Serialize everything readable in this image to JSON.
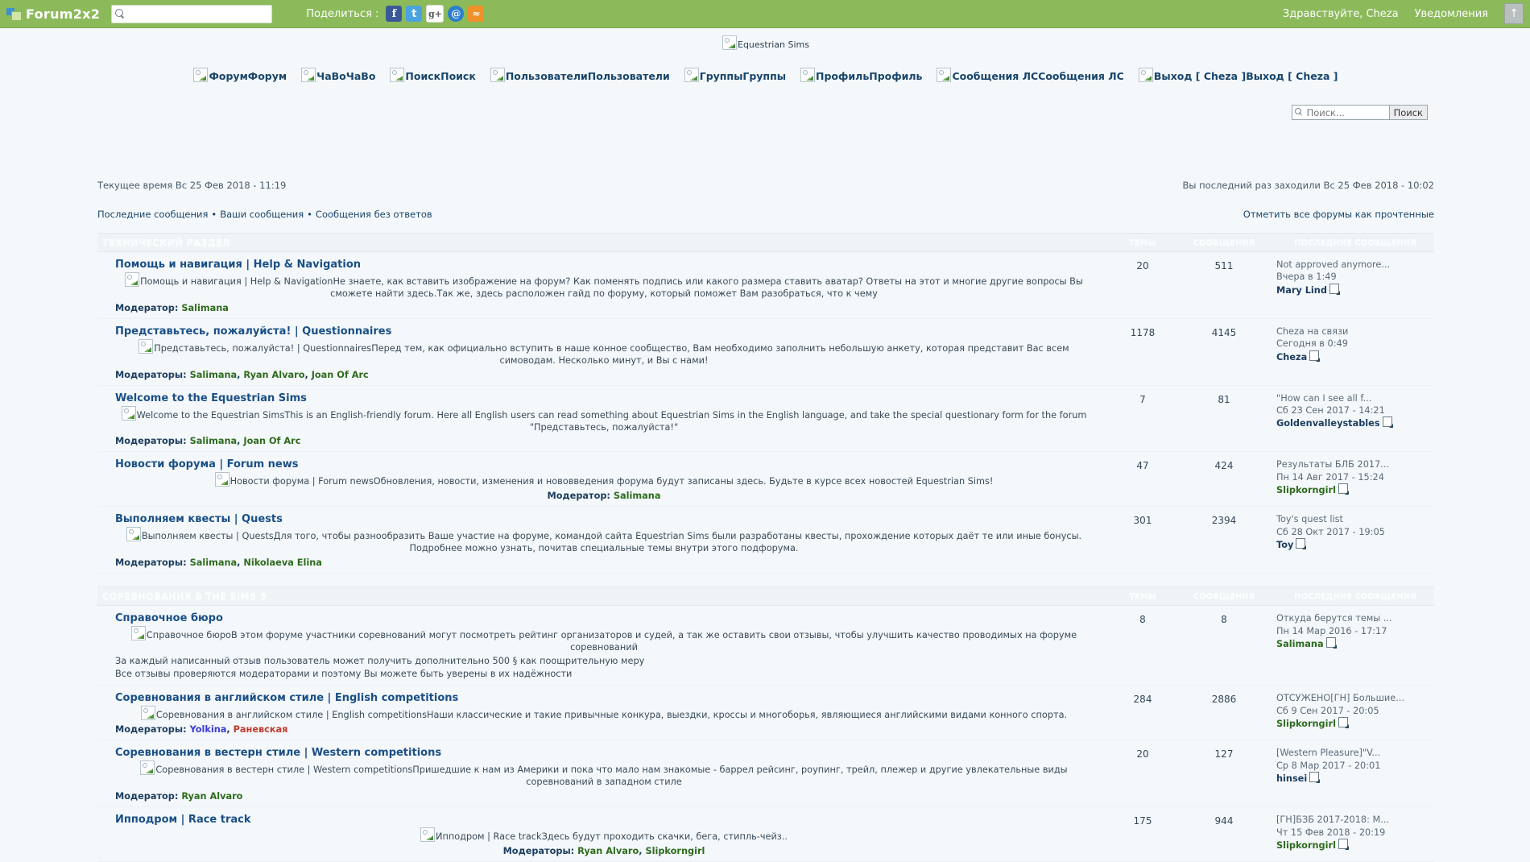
{
  "topbar": {
    "brand": "Forum2x2",
    "search_placeholder": "",
    "search_value": "",
    "share_label": "Поделиться :",
    "social": [
      {
        "name": "facebook-icon",
        "glyph": "f"
      },
      {
        "name": "twitter-icon",
        "glyph": "t"
      },
      {
        "name": "google-plus-icon",
        "glyph": "g+"
      },
      {
        "name": "email-icon",
        "glyph": "@"
      },
      {
        "name": "rss-icon",
        "glyph": "ᴿ"
      }
    ],
    "greeting": "Здравствуйте, Cheza",
    "notifications": "Уведомления",
    "scroll_top": "↑"
  },
  "header": {
    "logo_alt": "Equestrian Sims",
    "nav": [
      {
        "alt": "Форум",
        "label": "Форум"
      },
      {
        "alt": "ЧаВо",
        "label": "ЧаВо"
      },
      {
        "alt": "Поиск",
        "label": "Поиск"
      },
      {
        "alt": "Пользователи",
        "label": "Пользователи"
      },
      {
        "alt": "Группы",
        "label": "Группы"
      },
      {
        "alt": "Профиль",
        "label": "Профиль"
      },
      {
        "alt": "Сообщения ЛС",
        "label": "Сообщения ЛС"
      },
      {
        "alt": "Выход [ Cheza ]",
        "label": "Выход [ Cheza ]"
      }
    ],
    "search_placeholder": "Поиск...",
    "search_button": "Поиск"
  },
  "status": {
    "current_time": "Текущее время Вс 25 Фев 2018 - 11:19",
    "last_visit": "Вы последний раз заходили Вс 25 Фев 2018 - 10:02",
    "links": [
      "Последние сообщения",
      "Ваши сообщения",
      "Сообщения без ответов"
    ],
    "separator": "•",
    "mark_read": "Отметить все форумы как прочтенные"
  },
  "columns": {
    "topics": "Темы",
    "posts": "Сообщения",
    "last_post": "Последние сообщения"
  },
  "categories": [
    {
      "title": "Технический раздел",
      "forums": [
        {
          "name": "Помощь и навигация | Help & Navigation",
          "desc_alt": "Помощь и навигация | Help & Navigation",
          "desc": "Не знаете, как вставить изображение на форум? Как поменять подпись или какого размера ставить аватар? Ответы на этот и многие другие вопросы Вы сможете найти здесь.Так же, здесь расположен гайд по форуму, который поможет Вам разобраться, что к чему",
          "mod_label": "Модератор:",
          "mods": [
            {
              "name": "Salimana",
              "color": "m-green"
            }
          ],
          "mods_center": false,
          "topics": "20",
          "posts": "511",
          "last_title": "Not approved anymore...",
          "last_date": "Вчера в 1:49",
          "last_author": "Mary Lind",
          "last_author_color": "#1b3c5e"
        },
        {
          "name": "Представьтесь, пожалуйста! | Questionnaires",
          "desc_alt": "Представьтесь, пожалуйста! | Questionnaires",
          "desc": "Перед тем, как официально вступить в наше конное сообщество, Вам необходимо заполнить небольшую анкету, которая представит Вас всем симоводам. Несколько минут, и Вы с нами!",
          "mod_label": "Модераторы:",
          "mods": [
            {
              "name": "Salimana",
              "color": "m-green"
            },
            {
              "name": "Ryan Alvaro",
              "color": "m-green"
            },
            {
              "name": "Joan Of Arc",
              "color": "m-green"
            }
          ],
          "mods_center": false,
          "topics": "1178",
          "posts": "4145",
          "last_title": "Cheza на связи",
          "last_date": "Сегодня в 0:49",
          "last_author": "Cheza",
          "last_author_color": "#1b3c5e"
        },
        {
          "name": "Welcome to the Equestrian Sims",
          "desc_alt": "Welcome to the Equestrian Sims",
          "desc": "This is an English-friendly forum. Here all English users can read something about Equestrian Sims in the English language, and take the special questionary form for the forum \"Представьтесь, пожалуйста!\"",
          "mod_label": "Модераторы:",
          "mods": [
            {
              "name": "Salimana",
              "color": "m-green"
            },
            {
              "name": "Joan Of Arc",
              "color": "m-green"
            }
          ],
          "mods_center": false,
          "topics": "7",
          "posts": "81",
          "last_title": "\"How can I see all f...",
          "last_date": "Сб 23 Сен 2017 - 14:21",
          "last_author": "Goldenvalleystables",
          "last_author_color": "#1b3c5e"
        },
        {
          "name": "Новости форума | Forum news",
          "desc_alt": "Новости форума | Forum news",
          "desc": "Обновления, новости, изменения и нововведения форума будут записаны здесь. Будьте в курсе всех новостей Equestrian Sims!",
          "mod_label": "Модератор:",
          "mods": [
            {
              "name": "Salimana",
              "color": "m-green"
            }
          ],
          "mods_center": true,
          "topics": "47",
          "posts": "424",
          "last_title": "Результаты БЛБ 2017...",
          "last_date": "Пн 14 Авг 2017 - 15:24",
          "last_author": "Slipkorngirl",
          "last_author_color": "#2e6b1e"
        },
        {
          "name": "Выполняем квесты | Quests",
          "desc_alt": "Выполняем квесты | Quests",
          "desc": "Для того, чтобы разнообразить Ваше участие на форуме, командой сайта Equestrian Sims были разработаны квесты, прохождение которых даёт те или иные бонусы. Подробнее можно узнать, почитав специальные темы внутри этого подфорума.",
          "mod_label": "Модераторы:",
          "mods": [
            {
              "name": "Salimana",
              "color": "m-green"
            },
            {
              "name": "Nikolaeva Elina",
              "color": "m-green"
            }
          ],
          "mods_center": false,
          "topics": "301",
          "posts": "2394",
          "last_title": "Toy's quest list",
          "last_date": "Сб 28 Окт 2017 - 19:05",
          "last_author": "Toy",
          "last_author_color": "#1b3c5e"
        }
      ]
    },
    {
      "title": "Соревнования в The Sims 3",
      "forums": [
        {
          "name": "Справочное бюро",
          "desc_alt": "Справочное бюро",
          "desc": "В этом форуме участники соревнований могут посмотреть рейтинг организаторов и судей, а так же оставить свои отзывы, чтобы улучшить качество проводимых на форуме соревнований",
          "extra": [
            "За каждый написанный отзыв пользователь может получить дополнительно 500 § как поощрительную меру",
            "Все отзывы проверяются модераторами и поэтому Вы можете быть уверены в их надёжности"
          ],
          "mod_label": "",
          "mods": [],
          "mods_center": false,
          "topics": "8",
          "posts": "8",
          "last_title": "Откуда берутся темы ...",
          "last_date": "Пн 14 Мар 2016 - 17:17",
          "last_author": "Salimana",
          "last_author_color": "#2e6b1e"
        },
        {
          "name": "Соревнования в английском стиле | English competitions",
          "desc_alt": "Соревнования в английском стиле | English competitions",
          "desc": "Наши классические и такие привычные конкура, выездки, кроссы и многоборья, являющиеся английскими видами конного спорта.",
          "mod_label": "Модераторы:",
          "mods": [
            {
              "name": "Yolkina",
              "color": "m-blue"
            },
            {
              "name": "Раневская",
              "color": "m-red"
            }
          ],
          "mods_center": false,
          "topics": "284",
          "posts": "2886",
          "last_title": "ОТСУЖЕНО[ГН] Большие...",
          "last_date": "Сб 9 Сен 2017 - 20:05",
          "last_author": "Slipkorngirl",
          "last_author_color": "#2e6b1e"
        },
        {
          "name": "Соревнования в вестерн стиле | Western competitions",
          "desc_alt": "Соревнования в вестерн стиле | Western competitions",
          "desc": "Пришедшие к нам из Америки и пока что мало нам знакомые - баррел рейсинг, роупинг, трейл, плежер и другие увлекательные виды соревнований в западном стиле",
          "mod_label": "Модератор:",
          "mods": [
            {
              "name": "Ryan Alvaro",
              "color": "m-green"
            }
          ],
          "mods_center": false,
          "topics": "20",
          "posts": "127",
          "last_title": "[Western Pleasure]\"V...",
          "last_date": "Ср 8 Мар 2017 - 20:01",
          "last_author": "hinsei",
          "last_author_color": "#1b3c5e"
        },
        {
          "name": "Ипподром | Race track",
          "desc_alt": "Ипподром | Race track",
          "desc": "Здесь будут проходить скачки, бега, стипль-чейз..",
          "mod_label": "Модераторы:",
          "mods": [
            {
              "name": "Ryan Alvaro",
              "color": "m-green"
            },
            {
              "name": "Slipkorngirl",
              "color": "m-green"
            }
          ],
          "mods_center": true,
          "topics": "175",
          "posts": "944",
          "last_title": "[ГН]БЗБ 2017-2018: М...",
          "last_date": "Чт 15 Фев 2018 - 20:19",
          "last_author": "Slipkorngirl",
          "last_author_color": "#2e6b1e"
        }
      ]
    }
  ]
}
